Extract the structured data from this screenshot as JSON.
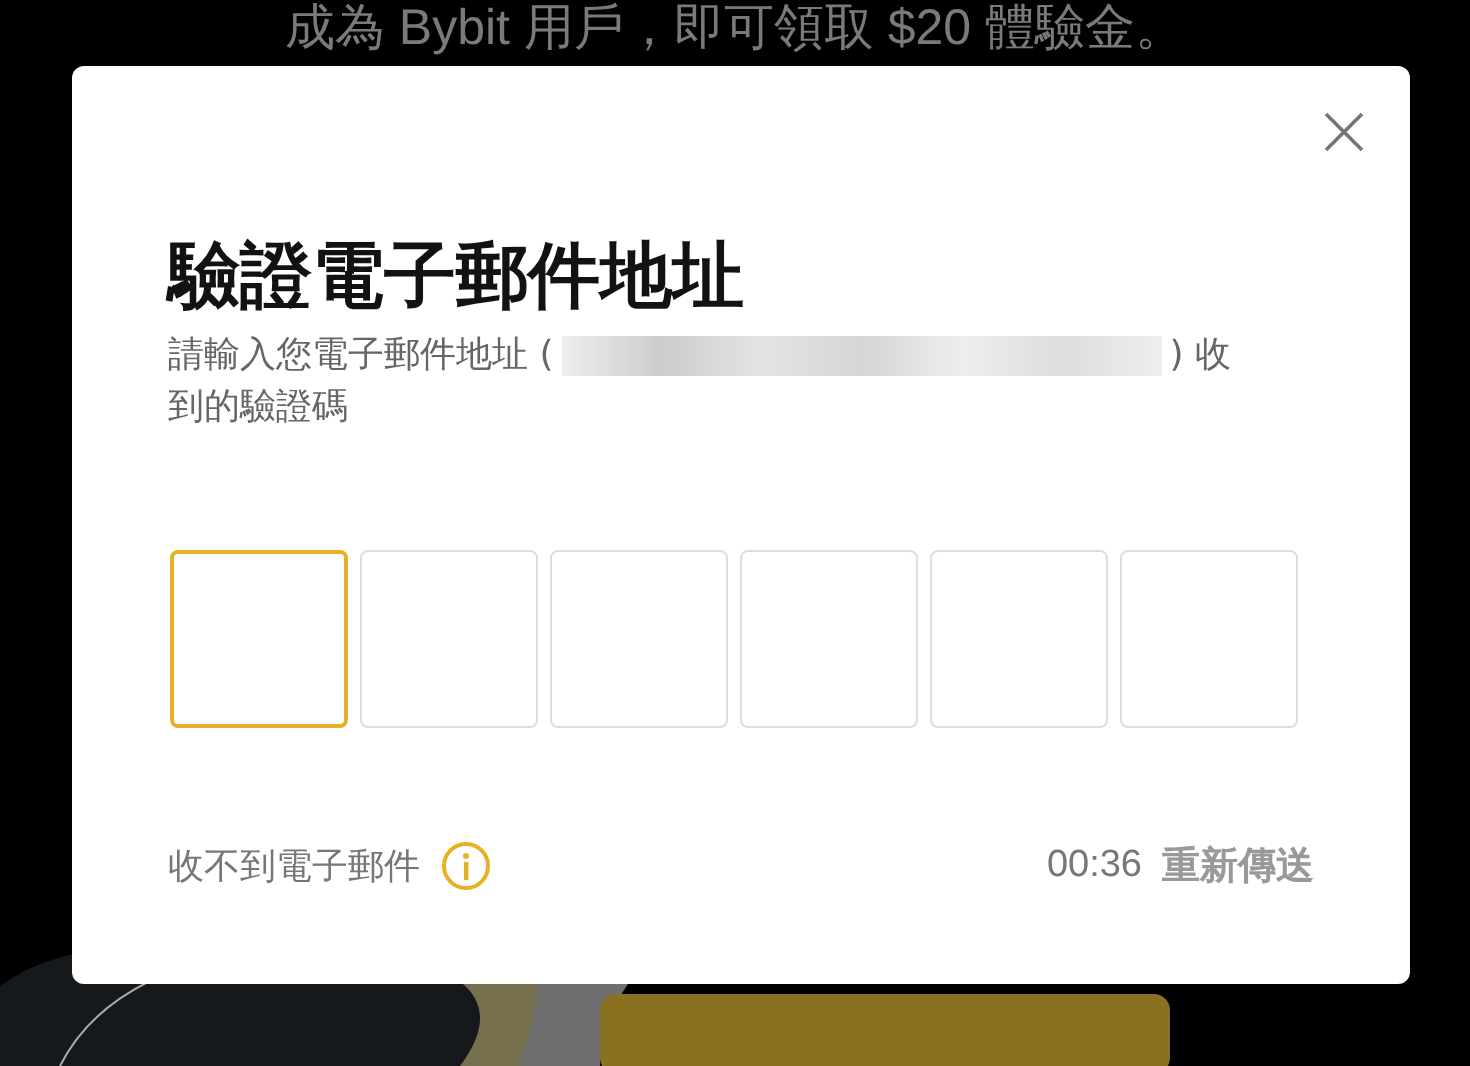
{
  "banner": {
    "text": "成為 Bybit 用戶，即可領取 $20 體驗金。"
  },
  "dialog": {
    "title": "驗證電子郵件地址",
    "subtitle_before": "請輸入您電子郵件地址 (",
    "subtitle_after": ") 收",
    "subtitle_line2": "到的驗證碼",
    "code_boxes": [
      {
        "selected": true
      },
      {
        "selected": false
      },
      {
        "selected": false
      },
      {
        "selected": false
      },
      {
        "selected": false
      },
      {
        "selected": false
      }
    ],
    "help_text": "收不到電子郵件",
    "timer": "00:36",
    "resend": "重新傳送"
  }
}
